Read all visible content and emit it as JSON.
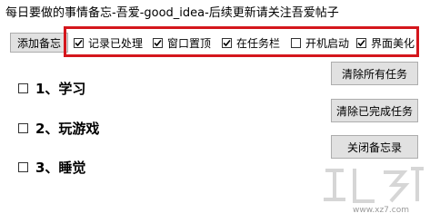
{
  "window": {
    "title": "每日要做的事情备忘-吾爱-good_idea-后续更新请关注吾爱帖子"
  },
  "toolbar": {
    "add_label": "添加备忘"
  },
  "options": [
    {
      "label": "记录已处理",
      "checked": true
    },
    {
      "label": "窗口置顶",
      "checked": true
    },
    {
      "label": "在任务栏",
      "checked": true
    },
    {
      "label": "开机启动",
      "checked": false
    },
    {
      "label": "界面美化",
      "checked": true
    }
  ],
  "tasks": [
    {
      "label": "1、学习",
      "checked": false
    },
    {
      "label": "2、玩游戏",
      "checked": false
    },
    {
      "label": "3、睡觉",
      "checked": false
    }
  ],
  "buttons": {
    "clear_all": "清除所有任务",
    "clear_done": "清除已完成任务",
    "close": "关闭备忘录"
  },
  "watermark": {
    "text": "www.xz7.com"
  },
  "colors": {
    "highlight_border": "#d4161c"
  }
}
